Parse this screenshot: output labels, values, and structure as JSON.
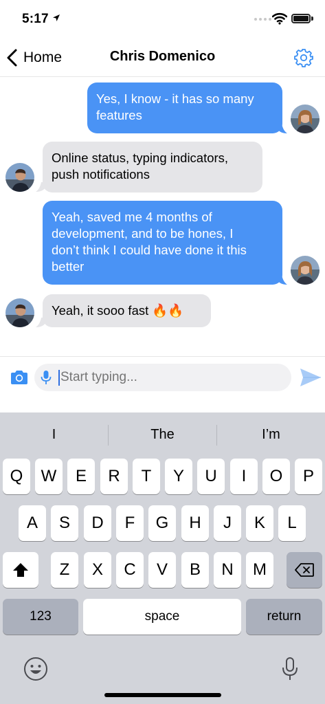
{
  "status_bar": {
    "time": "5:17"
  },
  "nav": {
    "back_label": "Home",
    "title": "Chris Domenico"
  },
  "messages": [
    {
      "direction": "outgoing",
      "lines": [
        "Yes, I know - it has so many",
        "features"
      ]
    },
    {
      "direction": "incoming",
      "lines": [
        "Online status, typing indicators,",
        "push notifications"
      ]
    },
    {
      "direction": "outgoing",
      "lines": [
        "Yeah, saved me 4 months of",
        "development, and to be hones, I",
        "don’t think I could have done it this",
        "better"
      ]
    },
    {
      "direction": "incoming",
      "lines": [
        "Yeah, it sooo fast 🔥🔥"
      ]
    }
  ],
  "composer": {
    "placeholder": "Start typing..."
  },
  "keyboard": {
    "suggestions": [
      "I",
      "The",
      "I’m"
    ],
    "row1": [
      "Q",
      "W",
      "E",
      "R",
      "T",
      "Y",
      "U",
      "I",
      "O",
      "P"
    ],
    "row2": [
      "A",
      "S",
      "D",
      "F",
      "G",
      "H",
      "J",
      "K",
      "L"
    ],
    "row3": [
      "Z",
      "X",
      "C",
      "V",
      "B",
      "N",
      "M"
    ],
    "numbers_label": "123",
    "space_label": "space",
    "return_label": "return"
  },
  "colors": {
    "accent": "#4a93f5",
    "incoming_bubble": "#e5e5e8",
    "keyboard_bg": "#d2d4da"
  },
  "icons": [
    "location-arrow-icon",
    "wifi-icon",
    "battery-icon",
    "chevron-left-icon",
    "gear-icon",
    "camera-icon",
    "microphone-icon",
    "send-icon",
    "shift-icon",
    "delete-icon",
    "emoji-icon"
  ]
}
